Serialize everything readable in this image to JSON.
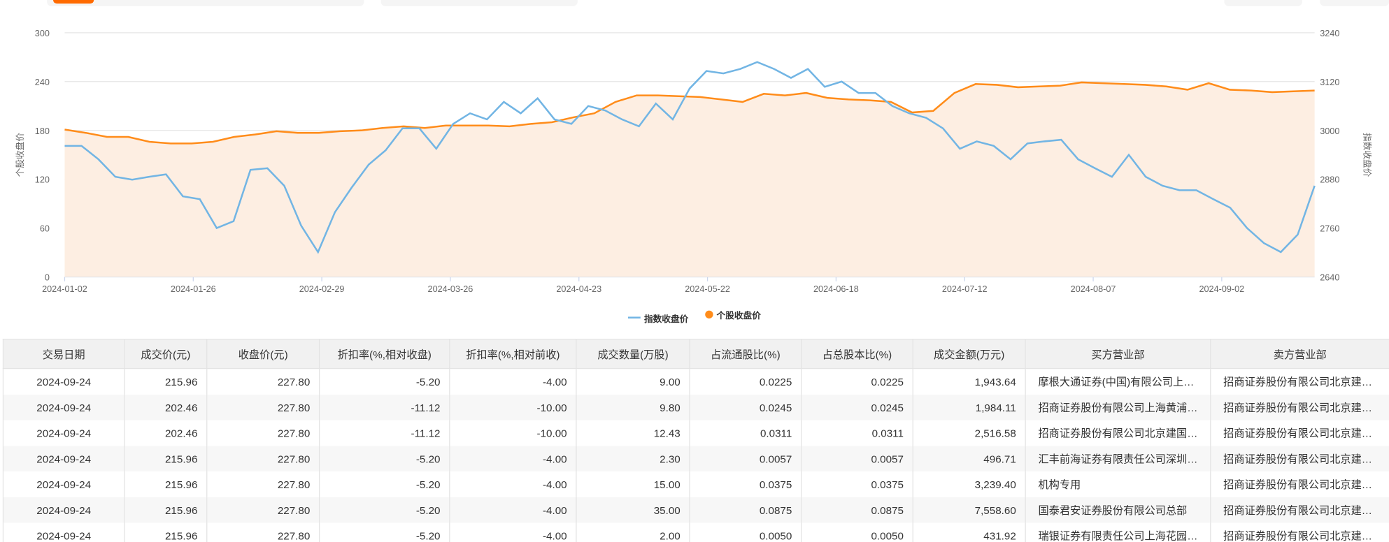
{
  "colors": {
    "index": "#72b5e4",
    "stock": "#ff8c1a",
    "stock_fill": "#fdeee2",
    "accent": "#ff6a00"
  },
  "chart_data": {
    "type": "line",
    "x_ticks": [
      "2024-01-02",
      "2024-01-26",
      "2024-02-29",
      "2024-03-26",
      "2024-04-23",
      "2024-05-22",
      "2024-06-18",
      "2024-07-12",
      "2024-08-07",
      "2024-09-02"
    ],
    "x_range": [
      "2024-01-02",
      "2024-09-24"
    ],
    "y_left": {
      "label": "个股收盘价",
      "range": [
        0,
        300
      ],
      "ticks": [
        "0",
        "60",
        "120",
        "180",
        "240",
        "300"
      ]
    },
    "y_right": {
      "label": "指数收盘价",
      "range": [
        2640,
        3240
      ],
      "ticks": [
        "2640",
        "2760",
        "2880",
        "3000",
        "3120",
        "3240"
      ]
    },
    "legend": [
      "指数收盘价",
      "个股收盘价"
    ],
    "series": [
      {
        "name": "指数收盘价",
        "axis": "right",
        "type": "line",
        "values": [
          2962,
          2962,
          2929,
          2886,
          2879,
          2886,
          2892,
          2838,
          2831,
          2760,
          2777,
          2903,
          2907,
          2864,
          2766,
          2701,
          2799,
          2860,
          2916,
          2951,
          3005,
          3005,
          2955,
          3016,
          3042,
          3027,
          3070,
          3042,
          3079,
          3027,
          3016,
          3060,
          3049,
          3027,
          3010,
          3066,
          3027,
          3103,
          3146,
          3140,
          3151,
          3168,
          3151,
          3129,
          3151,
          3107,
          3120,
          3092,
          3092,
          3060,
          3042,
          3031,
          3005,
          2955,
          2973,
          2962,
          2929,
          2968,
          2973,
          2977,
          2929,
          2907,
          2886,
          2940,
          2886,
          2864,
          2853,
          2853,
          2831,
          2810,
          2760,
          2723,
          2701,
          2744,
          2864
        ]
      },
      {
        "name": "个股收盘价",
        "axis": "left",
        "type": "area",
        "values": [
          181,
          177,
          172,
          172,
          166,
          164,
          164,
          166,
          172,
          175,
          179,
          177,
          177,
          179,
          180,
          183,
          185,
          183,
          186,
          186,
          186,
          185,
          188,
          190,
          196,
          201,
          215,
          223,
          223,
          222,
          221,
          218,
          215,
          225,
          223,
          226,
          220,
          218,
          217,
          215,
          202,
          204,
          226,
          237,
          236,
          233,
          234,
          235,
          239,
          238,
          237,
          236,
          234,
          230,
          238,
          230,
          229,
          227,
          228,
          229
        ]
      }
    ]
  },
  "table": {
    "headers": [
      "交易日期",
      "成交价(元)",
      "收盘价(元)",
      "折扣率(%,相对收盘)",
      "折扣率(%,相对前收)",
      "成交数量(万股)",
      "占流通股比(%)",
      "占总股本比(%)",
      "成交金额(万元)",
      "买方营业部",
      "卖方营业部"
    ],
    "rows": [
      [
        "2024-09-24",
        "215.96",
        "227.80",
        "-5.20",
        "-4.00",
        "9.00",
        "0.0225",
        "0.0225",
        "1,943.64",
        "摩根大通证券(中国)有限公司上海银城中路证券营业部",
        "招商证券股份有限公司北京建国路证券营业部"
      ],
      [
        "2024-09-24",
        "202.46",
        "227.80",
        "-11.12",
        "-10.00",
        "9.80",
        "0.0245",
        "0.0245",
        "1,984.11",
        "招商证券股份有限公司上海黄浦区证券营业部",
        "招商证券股份有限公司北京建国路证券营业部"
      ],
      [
        "2024-09-24",
        "202.46",
        "227.80",
        "-11.12",
        "-10.00",
        "12.43",
        "0.0311",
        "0.0311",
        "2,516.58",
        "招商证券股份有限公司北京建国路证券营业部",
        "招商证券股份有限公司北京建国路证券营业部"
      ],
      [
        "2024-09-24",
        "215.96",
        "227.80",
        "-5.20",
        "-4.00",
        "2.30",
        "0.0057",
        "0.0057",
        "496.71",
        "汇丰前海证券有限责任公司深圳分公司",
        "招商证券股份有限公司北京建国路证券营业部"
      ],
      [
        "2024-09-24",
        "215.96",
        "227.80",
        "-5.20",
        "-4.00",
        "15.00",
        "0.0375",
        "0.0375",
        "3,239.40",
        "机构专用",
        "招商证券股份有限公司北京建国路证券营业部"
      ],
      [
        "2024-09-24",
        "215.96",
        "227.80",
        "-5.20",
        "-4.00",
        "35.00",
        "0.0875",
        "0.0875",
        "7,558.60",
        "国泰君安证券股份有限公司总部",
        "招商证券股份有限公司北京建国路证券营业部"
      ],
      [
        "2024-09-24",
        "215.96",
        "227.80",
        "-5.20",
        "-4.00",
        "2.00",
        "0.0050",
        "0.0050",
        "431.92",
        "瑞银证券有限责任公司上海花园石桥路证券营业部",
        "招商证券股份有限公司北京建国路证券营业部"
      ]
    ]
  }
}
